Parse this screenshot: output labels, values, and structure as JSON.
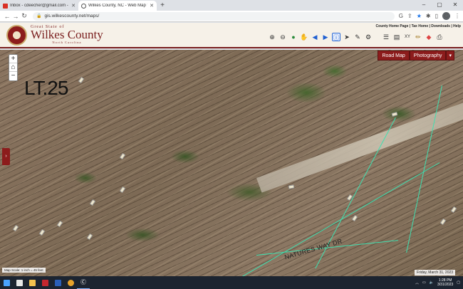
{
  "browser": {
    "tabs": [
      {
        "title": "Inbox - cdeecher@gmail.com - G",
        "active": false
      },
      {
        "title": "Wilkes County, NC - Web Map V",
        "active": true
      }
    ],
    "url": "gis.wilkescounty.net/maps/",
    "profile_initial": "C"
  },
  "header": {
    "great_state": "Great State of",
    "county": "Wilkes County",
    "state": "North Carolina",
    "links": [
      "County Home Page",
      "Tax Home",
      "Downloads",
      "Help"
    ]
  },
  "map": {
    "basemap_buttons": [
      "Road Map",
      "Photography"
    ],
    "lot_label": "LT.25",
    "road_label": "NATURES WAY DR",
    "scale_text": "Map Scale: 1 inch = 45 feet",
    "date_text": "Friday, March 31, 2023",
    "accent_color": "#8c1c1c",
    "parcel_line_color": "#3fe0b0"
  },
  "taskbar": {
    "time": "1:28 PM",
    "date": "3/31/2023"
  }
}
